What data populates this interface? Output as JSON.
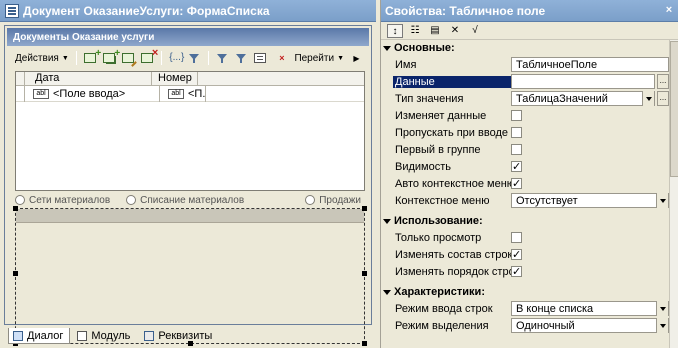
{
  "left_window": {
    "title": "Документ ОказаниеУслуги: ФормаСписка",
    "form_caption": "Документы Оказание услуги",
    "toolbar": {
      "actions_label": "Действия",
      "goto_label": "Перейти"
    },
    "grid": {
      "columns": [
        "Дата",
        "Номер"
      ],
      "row": {
        "date_cell": "<Поле ввода>",
        "num_cell": "<П...",
        "input_icon": "abl"
      }
    },
    "radios": [
      "Сети материалов",
      "Списание материалов",
      "Продажи"
    ],
    "tabs": [
      "Диалог",
      "Модуль",
      "Реквизиты"
    ],
    "active_tab": "Диалог"
  },
  "right_window": {
    "title": "Свойства: Табличное поле",
    "title_buttons": [
      "×",
      "x"
    ],
    "toolbar_icons": [
      "sort-icon",
      "categories-icon",
      "properties-icon",
      "close-icon",
      "check-icon"
    ],
    "sections": [
      {
        "name": "Основные:",
        "rows": [
          {
            "label": "Имя",
            "type": "text",
            "value": "ТабличноеПоле"
          },
          {
            "label": "Данные",
            "type": "text_button",
            "value": "",
            "selected": true
          },
          {
            "label": "Тип значения",
            "type": "select_button",
            "value": "ТаблицаЗначений"
          },
          {
            "label": "Изменяет данные",
            "type": "check",
            "value": false
          },
          {
            "label": "Пропускать при вводе",
            "type": "check",
            "value": false
          },
          {
            "label": "Первый в группе",
            "type": "check",
            "value": false
          },
          {
            "label": "Видимость",
            "type": "check",
            "value": true
          },
          {
            "label": "Авто контекстное меню",
            "type": "check",
            "value": true
          },
          {
            "label": "Контекстное меню",
            "type": "select",
            "value": "Отсутствует"
          }
        ]
      },
      {
        "name": "Использование:",
        "rows": [
          {
            "label": "Только просмотр",
            "type": "check",
            "value": false
          },
          {
            "label": "Изменять состав строк",
            "type": "check",
            "value": true
          },
          {
            "label": "Изменять порядок строк",
            "type": "check",
            "value": true
          }
        ]
      },
      {
        "name": "Характеристики:",
        "rows": [
          {
            "label": "Режим ввода строк",
            "type": "select",
            "value": "В конце списка"
          },
          {
            "label": "Режим выделения",
            "type": "select",
            "value": "Одиночный"
          }
        ]
      }
    ]
  }
}
